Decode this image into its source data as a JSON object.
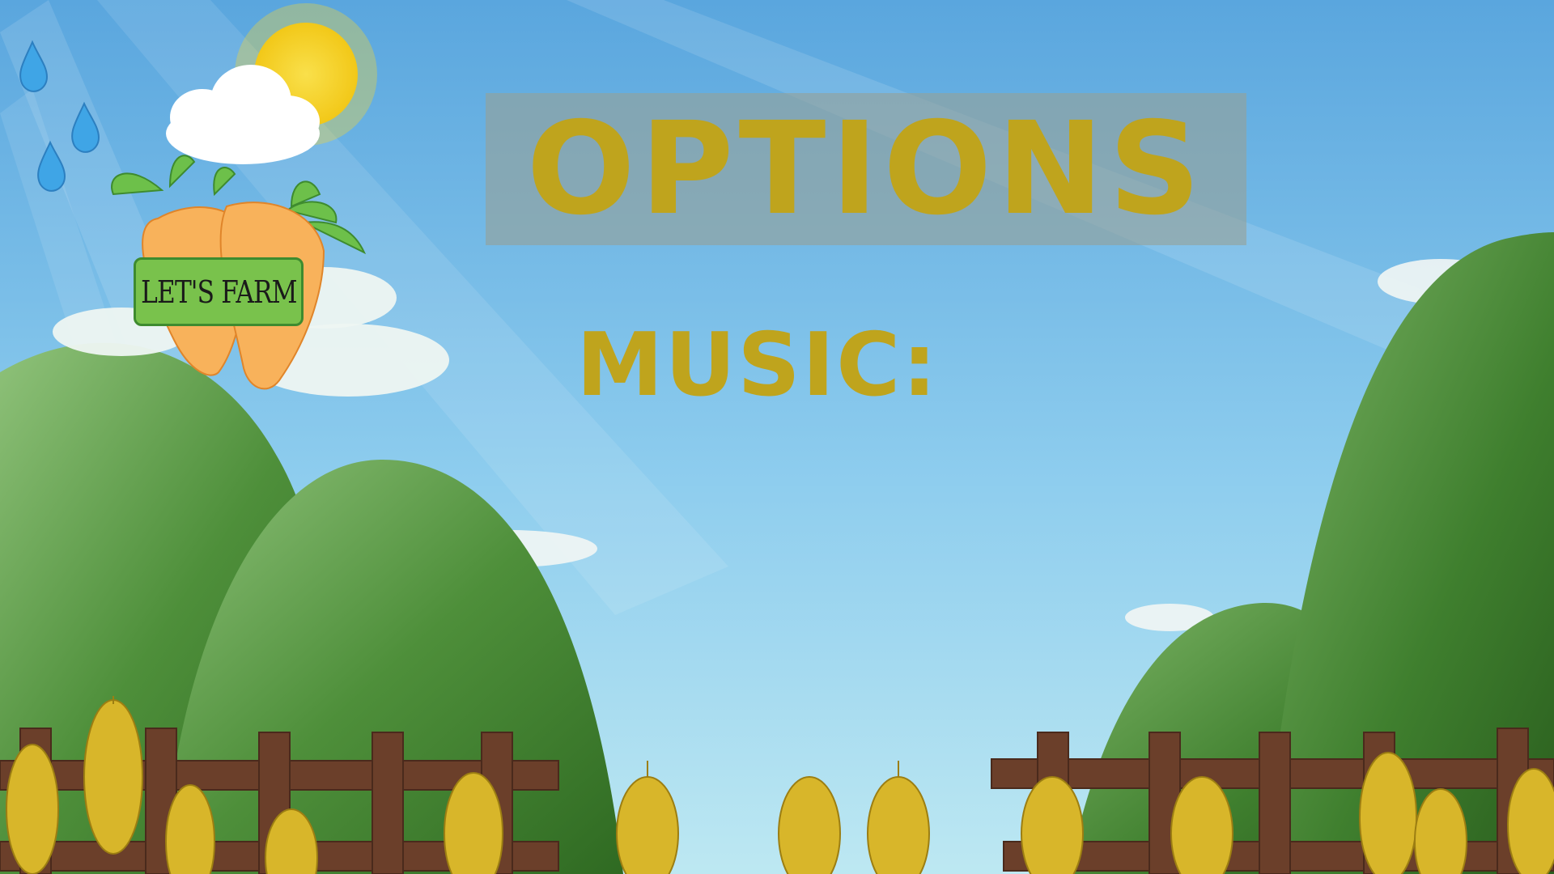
{
  "screen": {
    "title": "OPTIONS",
    "music_label": "MUSIC:"
  },
  "logo": {
    "text": "LET'S FARM"
  },
  "colors": {
    "title_text": "#BFA41D",
    "sky_top": "#5AA6DE",
    "sky_bottom": "#BDE8F2",
    "hill_green": "#4E8F3A",
    "carrot_orange": "#F8B25B",
    "sign_green": "#79C24C",
    "fence_brown": "#6B3F2A",
    "wheat_gold": "#D8B62A"
  },
  "icons": [
    "sun-icon",
    "cloud-icon",
    "raindrop-icon",
    "carrot-icon",
    "wheat-icon",
    "fence-icon"
  ]
}
